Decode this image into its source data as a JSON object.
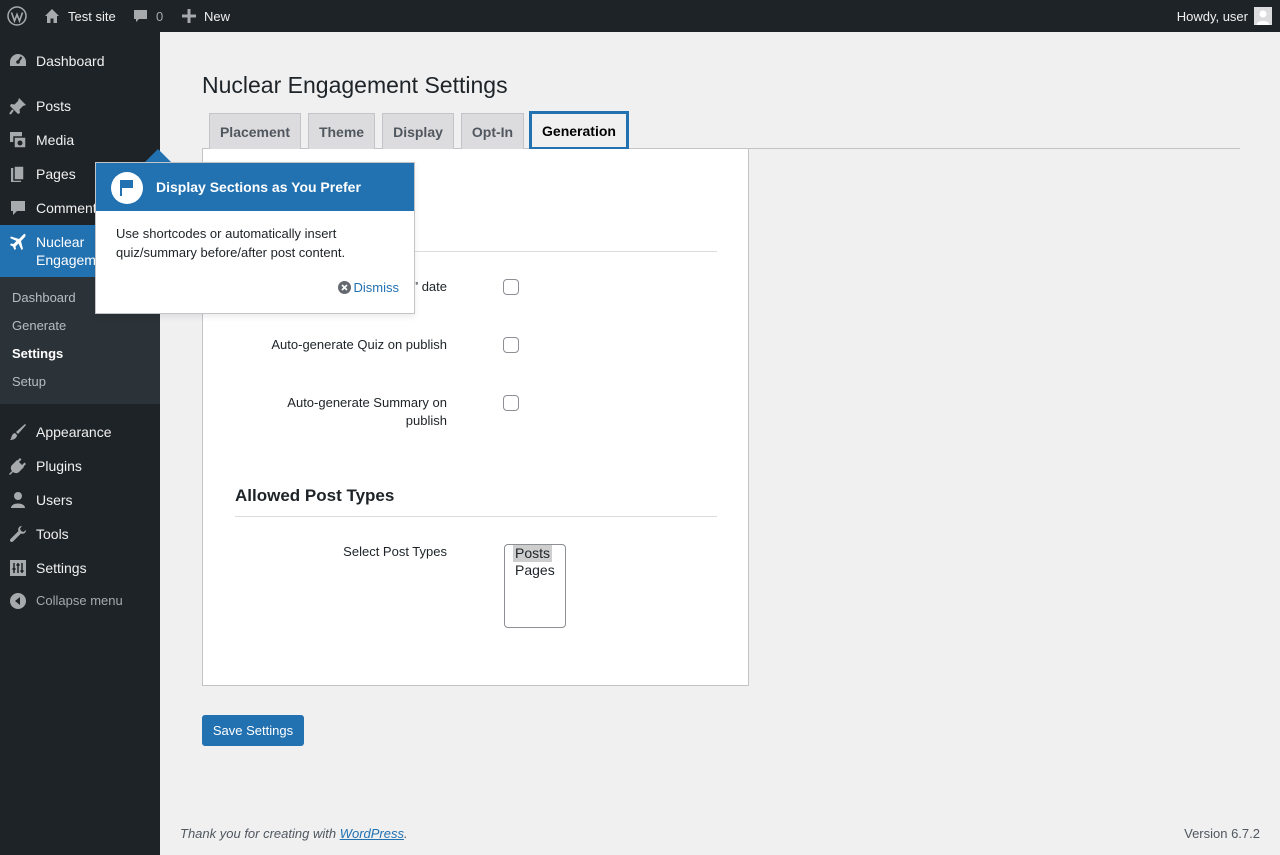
{
  "adminbar": {
    "site_name": "Test site",
    "comments_count": "0",
    "new_label": "New",
    "howdy": "Howdy, user"
  },
  "sidebar": {
    "items": [
      {
        "label": "Dashboard",
        "icon": "dashboard-icon"
      },
      {
        "label": "Posts",
        "icon": "pin-icon"
      },
      {
        "label": "Media",
        "icon": "media-icon"
      },
      {
        "label": "Pages",
        "icon": "pages-icon"
      },
      {
        "label": "Comments",
        "icon": "comments-icon"
      },
      {
        "label": "Nuclear Engagement",
        "icon": "airplane-icon"
      },
      {
        "label": "Appearance",
        "icon": "brush-icon"
      },
      {
        "label": "Plugins",
        "icon": "plug-icon"
      },
      {
        "label": "Users",
        "icon": "user-icon"
      },
      {
        "label": "Tools",
        "icon": "wrench-icon"
      },
      {
        "label": "Settings",
        "icon": "settings-icon"
      }
    ],
    "nuclear_line1": "Nuclear",
    "nuclear_line2": "Engagem",
    "comments_truncated": "Comment",
    "submenu": [
      "Dashboard",
      "Generate",
      "Settings",
      "Setup"
    ],
    "collapse_label": "Collapse menu"
  },
  "page": {
    "title": "Nuclear Engagement Settings",
    "tabs": [
      "Placement",
      "Theme",
      "Display",
      "Opt-In",
      "Generation"
    ],
    "active_tab": "Generation"
  },
  "generation": {
    "row1_label_visible": "\" date",
    "row2_label": "Auto-generate Quiz on publish",
    "row3_label_line1": "Auto-generate Summary on",
    "row3_label_line2": "publish",
    "allowed_title": "Allowed Post Types",
    "select_label": "Select Post Types",
    "post_types": [
      "Posts",
      "Pages"
    ],
    "selected_post_type": "Posts"
  },
  "save_label": "Save Settings",
  "pointer": {
    "title": "Display Sections as You Prefer",
    "body": "Use shortcodes or automatically insert quiz/summary before/after post content.",
    "dismiss": "Dismiss"
  },
  "footer": {
    "thanks_prefix": "Thank you for creating with ",
    "wordpress_link": "WordPress",
    "thanks_suffix": ".",
    "version": "Version 6.7.2"
  },
  "colors": {
    "accent": "#2271b1",
    "adminbar_bg": "#1d2327",
    "page_bg": "#f0f0f1"
  }
}
